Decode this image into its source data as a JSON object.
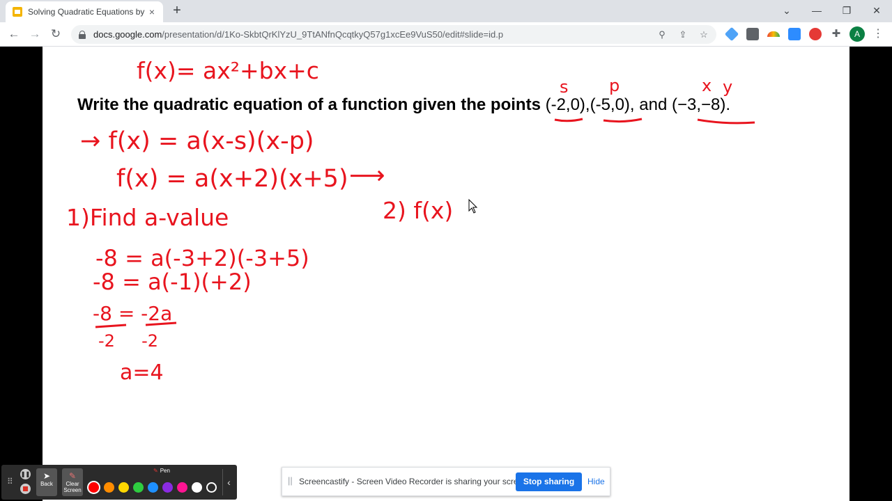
{
  "browser": {
    "tab_title": "Solving Quadratic Equations by G",
    "tab_close": "×",
    "new_tab": "+",
    "url_host": "docs.google.com",
    "url_path": "/presentation/d/1Ko-SkbtQrKlYzU_9TtANfnQcqtkyQ57g1xcEe9VuS50/edit#slide=id.p",
    "profile_initial": "A",
    "icons": [
      "back-icon",
      "forward-icon",
      "reload-icon",
      "lock-icon",
      "zoom-icon",
      "share-icon",
      "star-icon",
      "extensions-icon",
      "menu-icon"
    ]
  },
  "slide": {
    "question_text": "Write the quadratic equation of a function given the points ",
    "question_points": "(-2,0),(-5,0), and (−3,−8).",
    "handwriting": {
      "general_form": "f(x)= ax²+bx+c",
      "label_s": "s",
      "label_p": "p",
      "label_x": "x",
      "label_y": "y",
      "factored_form": "→ f(x) = a(x-s)(x-p)",
      "substituted": "f(x) = a(x+2)(x+5)",
      "arrow": "⟶",
      "step1": "1)Find a-value",
      "eq1": "-8 = a(-3+2)(-3+5)",
      "eq2": "-8 = a(-1)(+2)",
      "eq3_num": "-8 = -2a",
      "eq3_den": "-2     -2",
      "result": "a=4",
      "step2": "2) f(x)"
    }
  },
  "screencastify": {
    "back_label": "Back",
    "clear_label": "Clear Screen",
    "pen_label": "Pen",
    "colors": [
      "#ff0000",
      "#ff8c00",
      "#ffd700",
      "#2ecc40",
      "#1e90ff",
      "#8a2be2",
      "#ff1493",
      "#ffffff",
      "#2b2b2b"
    ]
  },
  "share_notice": {
    "text": "Screencastify - Screen Video Recorder is sharing your screen.",
    "stop_label": "Stop sharing",
    "hide_label": "Hide"
  }
}
